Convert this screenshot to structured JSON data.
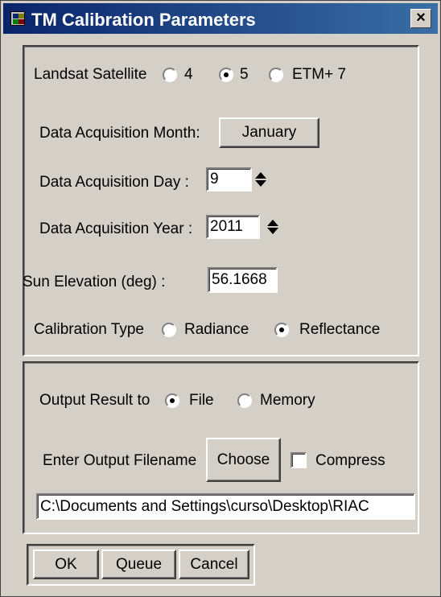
{
  "window": {
    "title": "TM Calibration Parameters",
    "close_label": "×"
  },
  "satellite": {
    "label": "Landsat Satellite",
    "options": [
      {
        "label": "4",
        "selected": false
      },
      {
        "label": "5",
        "selected": true
      },
      {
        "label": "ETM+ 7",
        "selected": false
      }
    ]
  },
  "month": {
    "label": "Data Acquisition Month:",
    "value": "January"
  },
  "day": {
    "label": "Data Acquisition Day  :",
    "value": "9"
  },
  "year": {
    "label": "Data Acquisition Year :",
    "value": "2011"
  },
  "sun": {
    "label": "Sun Elevation (deg)  :",
    "value": "56.1668"
  },
  "calibration": {
    "label": "Calibration Type",
    "options": [
      {
        "label": "Radiance",
        "selected": false
      },
      {
        "label": "Reflectance",
        "selected": true
      }
    ]
  },
  "output": {
    "label": "Output Result to",
    "options": [
      {
        "label": "File",
        "selected": true
      },
      {
        "label": "Memory",
        "selected": false
      }
    ],
    "filename_label": "Enter Output Filename",
    "choose_label": "Choose",
    "compress_label": "Compress",
    "compress_checked": false,
    "path": "C:\\Documents and Settings\\curso\\Desktop\\RIAC"
  },
  "buttons": {
    "ok": "OK",
    "queue": "Queue",
    "cancel": "Cancel"
  }
}
